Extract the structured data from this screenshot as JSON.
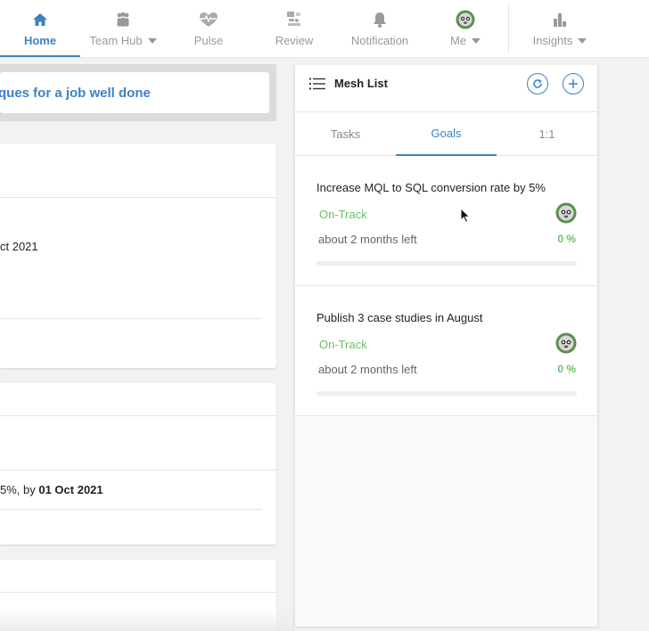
{
  "nav": {
    "items": [
      {
        "label": "Home",
        "icon": "home-icon"
      },
      {
        "label": "Team Hub",
        "icon": "team-icon"
      },
      {
        "label": "Pulse",
        "icon": "heart-pulse-icon"
      },
      {
        "label": "Review",
        "icon": "review-icon"
      },
      {
        "label": "Notification",
        "icon": "bell-icon"
      },
      {
        "label": "Me",
        "icon": "avatar-icon"
      },
      {
        "label": "Insights",
        "icon": "bar-chart-icon"
      }
    ],
    "active": "Home",
    "accent": "#3b82c4"
  },
  "left": {
    "banner_text": "ques for a job well done",
    "card1_date_text": "ct 2021",
    "card2_text_prefix": "5%, by ",
    "card2_date": "01 Oct 2021"
  },
  "panel": {
    "title": "Mesh List",
    "refresh_icon": "refresh-icon",
    "add_icon": "plus-icon",
    "tabs": [
      "Tasks",
      "Goals",
      "1:1"
    ],
    "active_tab": "Goals",
    "goals": [
      {
        "title": "Increase MQL to SQL conversion rate by 5%",
        "status": "On-Track",
        "time_left": "about 2 months left",
        "progress": "0 %",
        "progress_value": 0
      },
      {
        "title": "Publish 3 case studies in August",
        "status": "On-Track",
        "time_left": "about 2 months left",
        "progress": "0 %",
        "progress_value": 0
      }
    ],
    "status_color": "#6abf69"
  }
}
